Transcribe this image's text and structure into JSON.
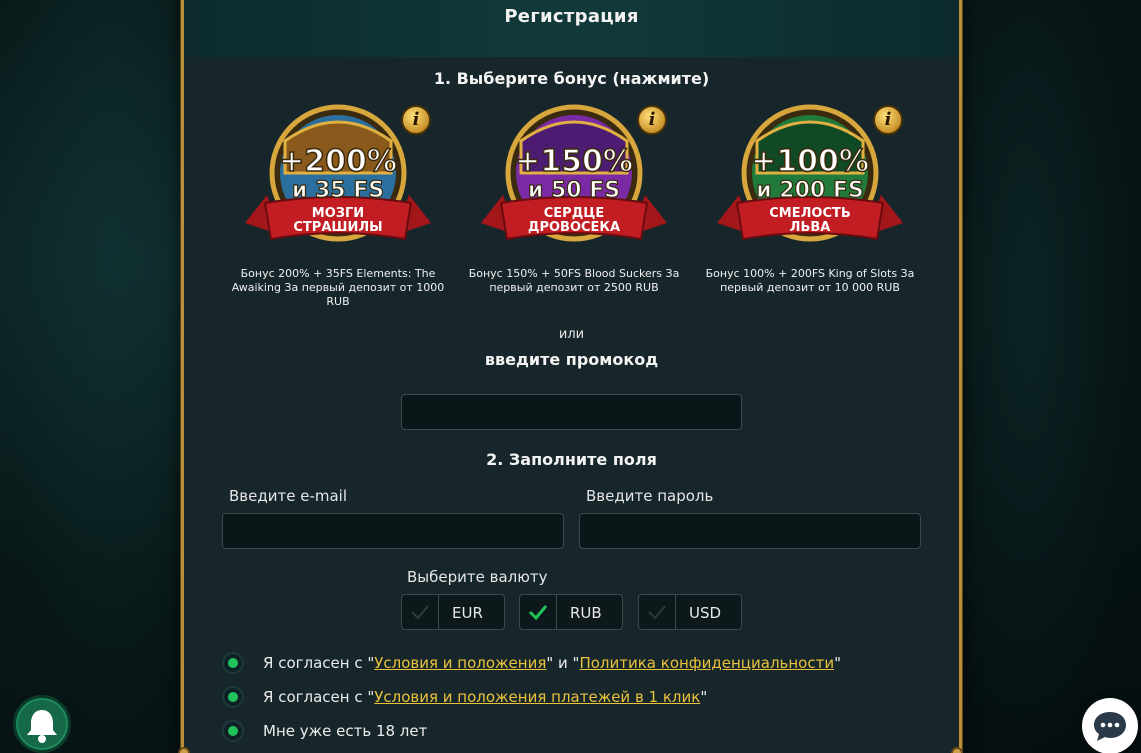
{
  "modal": {
    "title": "Регистрация",
    "step1_title": "1. Выберите бонус (нажмите)",
    "bonuses": [
      {
        "percent": "+200%",
        "fs": "и 35 FS",
        "ribbon_line1": "МОЗГИ",
        "ribbon_line2": "СТРАШИЛЫ",
        "color": "#2a6f9e",
        "description": "Бонус 200% + 35FS Elements: The Awaiking За первый депозит от 1000 RUB"
      },
      {
        "percent": "+150%",
        "fs": "и 50 FS",
        "ribbon_line1": "СЕРДЦЕ",
        "ribbon_line2": "ДРОВОСЕКА",
        "color": "#7a2aa5",
        "description": "Бонус 150% + 50FS Blood Suckers За первый депозит от 2500 RUB"
      },
      {
        "percent": "+100%",
        "fs": "и 200 FS",
        "ribbon_line1": "СМЕЛОСТЬ",
        "ribbon_line2": "ЛЬВА",
        "color": "#1f7a3c",
        "description": "Бонус 100% + 200FS King of Slots За первый депозит от 10 000 RUB"
      }
    ],
    "or_text": "или",
    "promo_label": "введите промокод",
    "promo_value": "",
    "step2_title": "2. Заполните поля",
    "email_label": "Введите e-mail",
    "email_value": "",
    "password_label": "Введите пароль",
    "password_value": "",
    "currency_label": "Выберите валюту",
    "currencies": [
      {
        "code": "EUR",
        "selected": false
      },
      {
        "code": "RUB",
        "selected": true
      },
      {
        "code": "USD",
        "selected": false
      }
    ],
    "agreements": [
      {
        "prefix": "Я согласен с \"",
        "link1": "Условия и положения",
        "middle": "\" и \"",
        "link2": "Политика конфиденциальности",
        "suffix": "\""
      },
      {
        "prefix": "Я согласен с \"",
        "link1": "Условия и положения платежей в 1 клик",
        "suffix": "\""
      },
      {
        "text": "Мне уже есть 18 лет"
      }
    ]
  },
  "colors": {
    "accent_gold": "#b98f3c",
    "link_yellow": "#e9c23c",
    "check_green": "#20c35a",
    "bell_green": "#156848"
  },
  "icons": {
    "notification": "bell-icon",
    "chat": "chat-icon",
    "info": "info-icon",
    "check": "check-icon"
  }
}
